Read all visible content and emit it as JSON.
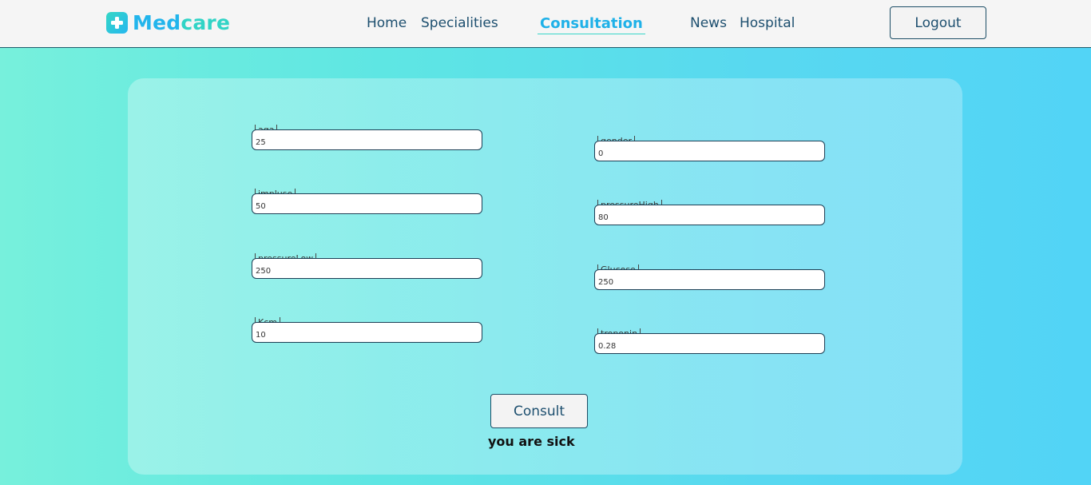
{
  "brand": {
    "med": "Med",
    "care": "care"
  },
  "nav": {
    "home": "Home",
    "specialities": "Specialities",
    "consultation": "Consultation",
    "news": "News",
    "hospital": "Hospital",
    "logout": "Logout"
  },
  "colors": {
    "accent": "#1fb1e8",
    "secondary": "#31d4c6",
    "text": "#1d4f6f"
  },
  "form": {
    "left": [
      {
        "label": "aga",
        "value": "25"
      },
      {
        "label": "impluse",
        "value": "50"
      },
      {
        "label": "pressureLow",
        "value": "250"
      },
      {
        "label": "Kcm",
        "value": "10"
      }
    ],
    "right": [
      {
        "label": "gender",
        "value": "0"
      },
      {
        "label": "pressureHigh",
        "value": "80"
      },
      {
        "label": "Glucose",
        "value": "250"
      },
      {
        "label": "troponin",
        "value": "0.28"
      }
    ],
    "consult_label": "Consult",
    "result": "you are sick"
  }
}
